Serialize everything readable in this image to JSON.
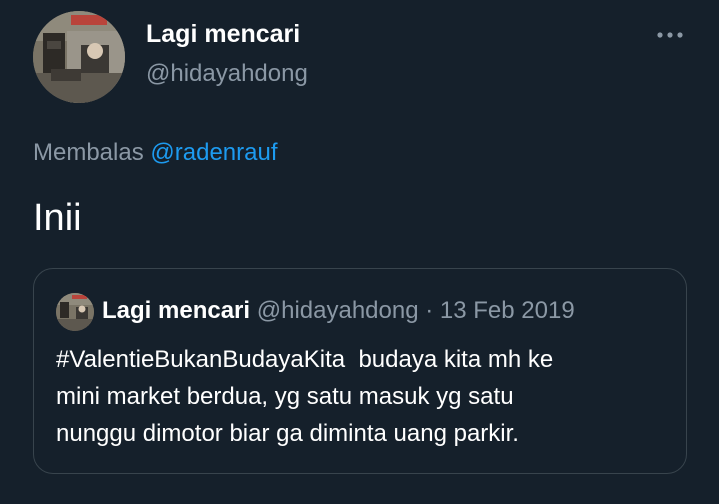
{
  "tweet": {
    "author": {
      "display_name": "Lagi mencari",
      "handle": "@hidayahdong"
    },
    "more_icon": "more-horizontal-icon",
    "reply_prefix": "Membalas",
    "reply_mention": "@radenrauf",
    "text": "Inii"
  },
  "quoted_tweet": {
    "display_name": "Lagi mencari",
    "handle": "@hidayahdong",
    "separator": "·",
    "date": "13 Feb 2019",
    "text": "#ValentieBukanBudayaKita  budaya kita mh ke\nmini market berdua, yg satu masuk yg satu\nnunggu dimotor biar ga diminta uang parkir."
  },
  "colors": {
    "background": "#15202b",
    "text_primary": "#ffffff",
    "text_secondary": "#8b98a5",
    "accent": "#1d9bf0",
    "border": "#38444d"
  }
}
